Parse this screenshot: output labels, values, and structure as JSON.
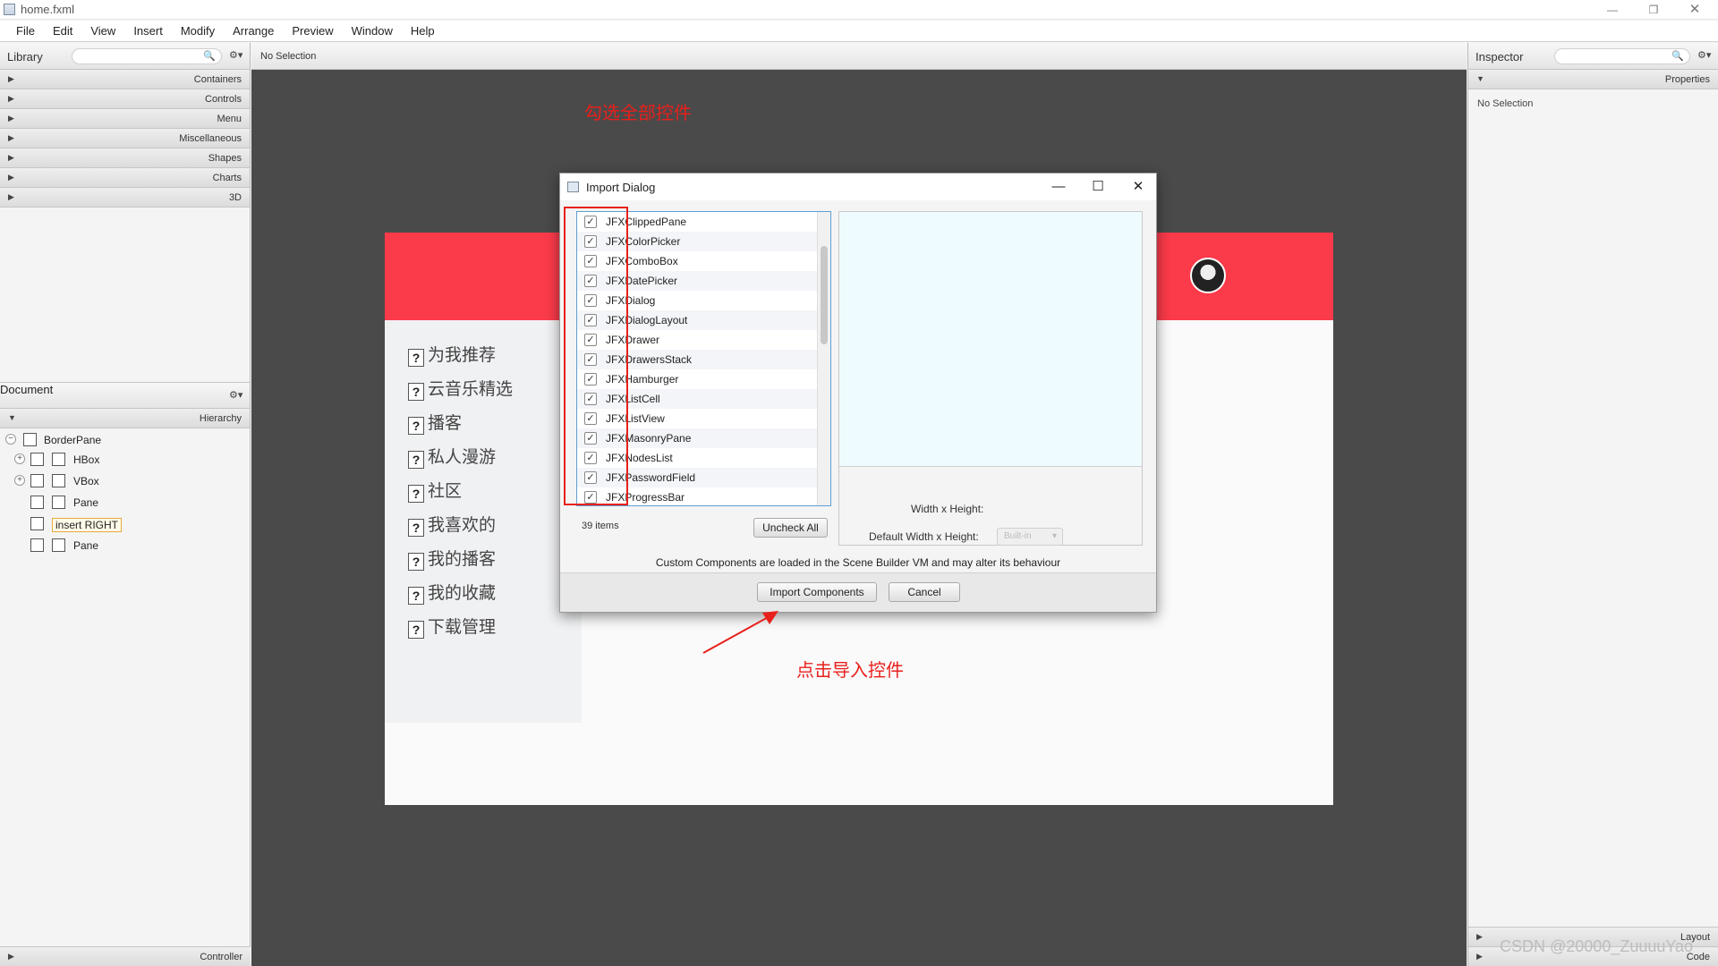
{
  "window": {
    "title": "home.fxml",
    "minimize": "—",
    "restore": "❐"
  },
  "menu": [
    "File",
    "Edit",
    "View",
    "Insert",
    "Modify",
    "Arrange",
    "Preview",
    "Window",
    "Help"
  ],
  "library": {
    "title": "Library",
    "sections": [
      "Containers",
      "Controls",
      "Menu",
      "Miscellaneous",
      "Shapes",
      "Charts",
      "3D"
    ]
  },
  "document": {
    "title": "Document",
    "hierarchy_label": "Hierarchy",
    "tree": [
      "BorderPane",
      "HBox",
      "VBox",
      "Pane",
      "insert RIGHT",
      "Pane"
    ]
  },
  "controller_label": "Controller",
  "center": {
    "selection": "No Selection"
  },
  "design": {
    "nav": [
      "为我推荐",
      "云音乐精选",
      "播客",
      "私人漫游",
      "社区",
      "我喜欢的",
      "我的播客",
      "我的收藏",
      "下载管理"
    ]
  },
  "dialog": {
    "title": "Import Dialog",
    "items": [
      "JFXClippedPane",
      "JFXColorPicker",
      "JFXComboBox",
      "JFXDatePicker",
      "JFXDialog",
      "JFXDialogLayout",
      "JFXDrawer",
      "JFXDrawersStack",
      "JFXHamburger",
      "JFXListCell",
      "JFXListView",
      "JFXMasonryPane",
      "JFXNodesList",
      "JFXPasswordField",
      "JFXProgressBar"
    ],
    "item_count": "39 items",
    "uncheck_all": "Uncheck All",
    "width_height": "Width x Height:",
    "default_width_height": "Default Width x Height:",
    "default_value": "Built-in",
    "note": "Custom Components are loaded in the Scene Builder VM and may alter its behaviour",
    "import_button": "Import Components",
    "cancel_button": "Cancel"
  },
  "annotations": {
    "check_all": "勾选全部控件",
    "click_import": "点击导入控件"
  },
  "inspector": {
    "title": "Inspector",
    "properties": "Properties",
    "no_selection": "No Selection",
    "layout": "Layout",
    "code": "Code"
  },
  "watermark": "CSDN @20000_ZuuuuYao",
  "colors": {
    "banner": "#fb3a4a",
    "annotation": "#e8201c",
    "focus": "#5f9ed2",
    "preview": "#effcff"
  }
}
